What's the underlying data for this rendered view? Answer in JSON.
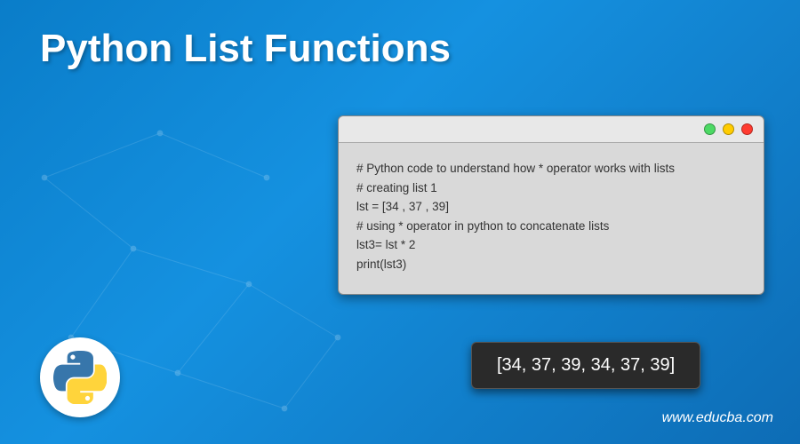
{
  "title": "Python List Functions",
  "code_window": {
    "lines": [
      "# Python code to understand how * operator works with lists",
      "# creating list 1",
      "lst = [34 , 37 , 39]",
      "# using * operator in python to concatenate lists",
      "lst3= lst * 2",
      "print(lst3)"
    ]
  },
  "output": "[34, 37, 39, 34, 37, 39]",
  "website": "www.educba.com",
  "logo_name": "python-logo"
}
